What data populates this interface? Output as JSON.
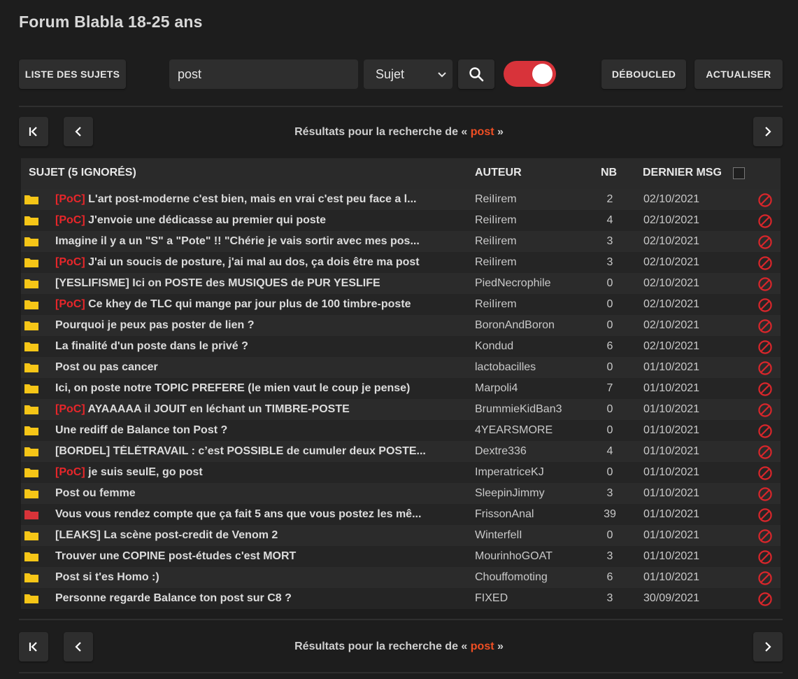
{
  "header": {
    "title": "Forum Blabla 18-25 ans"
  },
  "toolbar": {
    "list_label": "LISTE DES SUJETS",
    "search_value": "post",
    "select_value": "Sujet",
    "toggle_on": true,
    "unloop_label": "DÉBOUCLED",
    "refresh_label": "ACTUALISER"
  },
  "pager": {
    "results_prefix": "Résultats pour la recherche de « ",
    "query": "post",
    "results_suffix": " »"
  },
  "table": {
    "col_subject": "SUJET (5 IGNORÉS)",
    "col_author": "AUTEUR",
    "col_nb": "NB",
    "col_last": "DERNIER MSG",
    "rows": [
      {
        "tag": "[PoC]",
        "subject": "L'art post-moderne c'est bien, mais en vrai c'est peu face a l...",
        "author": "ReiIirem",
        "nb": "2",
        "date": "02/10/2021",
        "folder": "yellow"
      },
      {
        "tag": "[PoC]",
        "subject": "J'envoie une dédicasse au premier qui poste",
        "author": "ReiIirem",
        "nb": "4",
        "date": "02/10/2021",
        "folder": "yellow"
      },
      {
        "tag": "",
        "subject": "Imagine il y a un \"S\" a \"Pote\" !! \"Chérie je vais sortir avec mes pos...",
        "author": "ReiIirem",
        "nb": "3",
        "date": "02/10/2021",
        "folder": "yellow"
      },
      {
        "tag": "[PoC]",
        "subject": "J'ai un soucis de posture, j'ai mal au dos, ça dois être ma post",
        "author": "ReiIirem",
        "nb": "3",
        "date": "02/10/2021",
        "folder": "yellow"
      },
      {
        "tag": "",
        "subject": "[YESLIFISME] Ici on POSTE des MUSIQUES de PUR YESLIFE",
        "author": "PiedNecrophile",
        "nb": "0",
        "date": "02/10/2021",
        "folder": "yellow"
      },
      {
        "tag": "[PoC]",
        "subject": "Ce khey de TLC qui mange par jour plus de 100 timbre-poste",
        "author": "ReiIirem",
        "nb": "0",
        "date": "02/10/2021",
        "folder": "yellow"
      },
      {
        "tag": "",
        "subject": "Pourquoi je peux pas poster de lien ?",
        "author": "BoronAndBoron",
        "nb": "0",
        "date": "02/10/2021",
        "folder": "yellow"
      },
      {
        "tag": "",
        "subject": "La finalité d'un poste dans le privé ?",
        "author": "Kondud",
        "nb": "6",
        "date": "02/10/2021",
        "folder": "yellow"
      },
      {
        "tag": "",
        "subject": "Post ou pas cancer",
        "author": "lactobacilles",
        "nb": "0",
        "date": "01/10/2021",
        "folder": "yellow"
      },
      {
        "tag": "",
        "subject": "Ici, on poste notre TOPIC PREFERE (le mien vaut le coup je pense)",
        "author": "Marpoli4",
        "nb": "7",
        "date": "01/10/2021",
        "folder": "yellow"
      },
      {
        "tag": "[PoC]",
        "subject": "AYAAAAA il JOUIT en léchant un TIMBRE-POSTE",
        "author": "BrummieKidBan3",
        "nb": "0",
        "date": "01/10/2021",
        "folder": "yellow"
      },
      {
        "tag": "",
        "subject": "Une rediff de Balance ton Post ?",
        "author": "4YEARSMORE",
        "nb": "0",
        "date": "01/10/2021",
        "folder": "yellow"
      },
      {
        "tag": "",
        "subject": "[BORDEL] TÉLÉTRAVAIL : c’est POSSIBLE de cumuler deux POSTE...",
        "author": "Dextre336",
        "nb": "4",
        "date": "01/10/2021",
        "folder": "yellow"
      },
      {
        "tag": "[PoC]",
        "subject": "je suis seulE, go post",
        "author": "ImperatriceKJ",
        "nb": "0",
        "date": "01/10/2021",
        "folder": "yellow"
      },
      {
        "tag": "",
        "subject": "Post ou femme",
        "author": "SleepinJimmy",
        "nb": "3",
        "date": "01/10/2021",
        "folder": "yellow"
      },
      {
        "tag": "",
        "subject": "Vous vous rendez compte que ça fait 5 ans que vous postez les mê...",
        "author": "FrissonAnal",
        "nb": "39",
        "date": "01/10/2021",
        "folder": "red"
      },
      {
        "tag": "",
        "subject": "[LEAKS] La scène post-credit de Venom 2",
        "author": "WinterfelI",
        "nb": "0",
        "date": "01/10/2021",
        "folder": "yellow"
      },
      {
        "tag": "",
        "subject": "Trouver une COPINE post-études c'est MORT",
        "author": "MourinhoGOAT",
        "nb": "3",
        "date": "01/10/2021",
        "folder": "yellow"
      },
      {
        "tag": "",
        "subject": "Post si t'es Homo :)",
        "author": "Chouffomoting",
        "nb": "6",
        "date": "01/10/2021",
        "folder": "yellow"
      },
      {
        "tag": "",
        "subject": "Personne regarde Balance ton post sur C8 ?",
        "author": "FIXED",
        "nb": "3",
        "date": "30/09/2021",
        "folder": "yellow"
      }
    ]
  },
  "colors": {
    "accent": "#f04e23",
    "tag": "#e8262a",
    "toggle": "#d8333a",
    "folder_yellow": "#f5c518",
    "folder_red": "#d8333a"
  }
}
